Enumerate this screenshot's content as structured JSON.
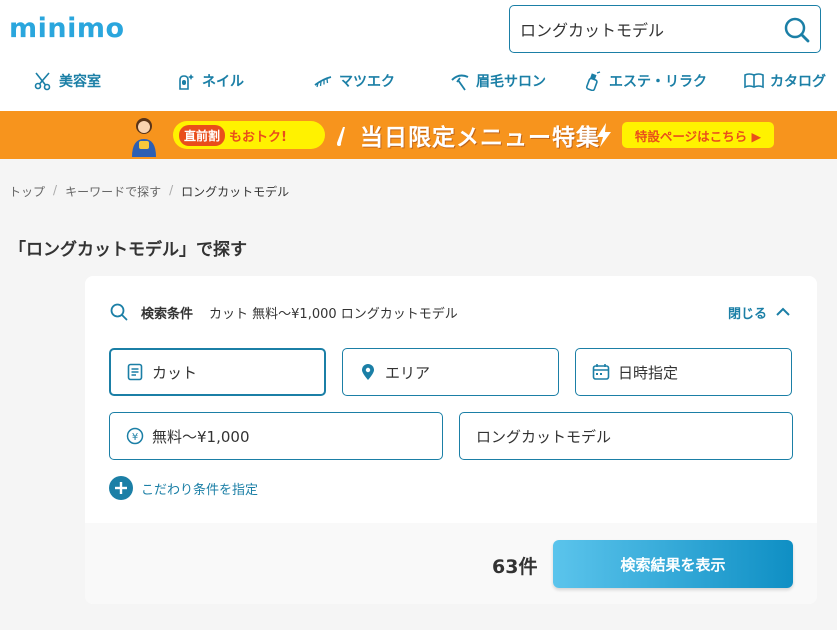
{
  "header": {
    "logo": "minimo",
    "search": {
      "value": "ロングカットモデル",
      "placeholder": ""
    }
  },
  "nav": {
    "items": [
      {
        "label": "美容室",
        "icon": "scissors-icon"
      },
      {
        "label": "ネイル",
        "icon": "nail-icon"
      },
      {
        "label": "マツエク",
        "icon": "eyelash-icon"
      },
      {
        "label": "眉毛サロン",
        "icon": "eyebrow-icon"
      },
      {
        "label": "エステ・リラク",
        "icon": "spray-bottle-icon"
      },
      {
        "label": "カタログ",
        "icon": "book-icon"
      }
    ]
  },
  "banner": {
    "tag": "直前割",
    "tag_text": "もおトク!",
    "headline": "当日限定メニュー特集",
    "cta": "特設ページはこちら ▶",
    "bg_color": "#f7941d",
    "accent_color": "#fff200"
  },
  "breadcrumb": {
    "items": [
      "トップ",
      "キーワードで探す"
    ],
    "current": "ロングカットモデル"
  },
  "page_title": "「ロングカットモデル」で探す",
  "conditions": {
    "label": "検索条件",
    "summary": "カット 無料〜¥1,000 ロングカットモデル",
    "toggle_label": "閉じる"
  },
  "fields": {
    "menu": "カット",
    "area": "エリア",
    "datetime": "日時指定",
    "price": "無料〜¥1,000",
    "keyword": "ロングカットモデル"
  },
  "more_conditions": "こだわり条件を指定",
  "result": {
    "count": "63件",
    "button_label": "検索結果を表示"
  },
  "colors": {
    "primary": "#1b7fa6",
    "logo": "#2aa6dd"
  }
}
